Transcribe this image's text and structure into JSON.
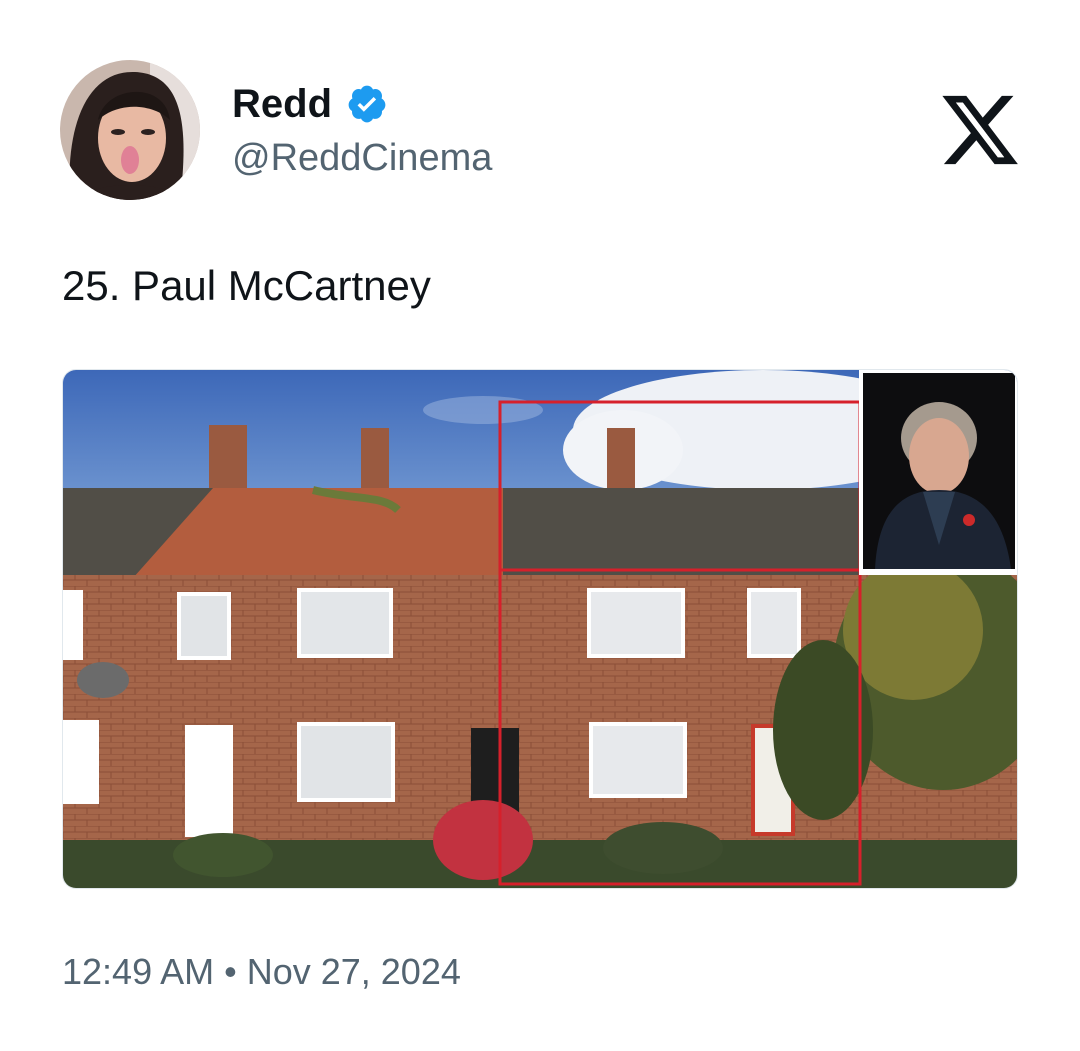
{
  "author": {
    "name": "Redd",
    "handle": "@ReddCinema",
    "verified": true,
    "avatar_icon": "profile-photo"
  },
  "platform_icon": "x-logo-icon",
  "tweet": {
    "text": "25. Paul McCartney"
  },
  "media": {
    "description_icon": "photo-house-terrace",
    "inset_icon": "photo-portrait"
  },
  "meta": {
    "time": "12:49 AM",
    "separator": "•",
    "date": "Nov 27, 2024"
  },
  "colors": {
    "verified_blue": "#1d9bf0",
    "text_primary": "#0f1419",
    "text_secondary": "#536471",
    "highlight_red": "#d6202b"
  }
}
